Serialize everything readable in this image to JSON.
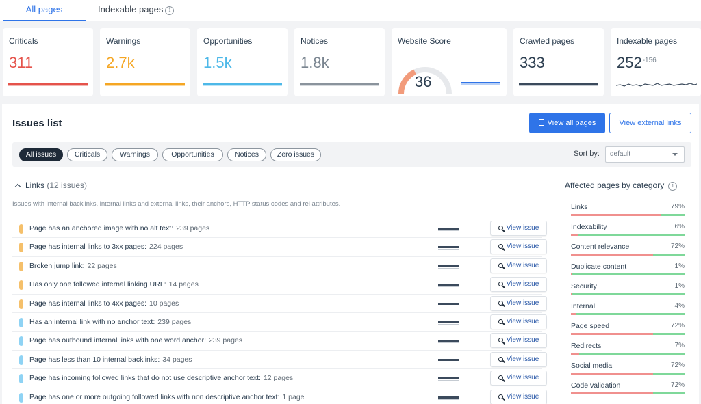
{
  "tabs": [
    {
      "label": "All pages",
      "active": true
    },
    {
      "label": "Indexable pages",
      "active": false
    }
  ],
  "cards": {
    "criticals": {
      "label": "Criticals",
      "value": "311",
      "color": "#e5534b"
    },
    "warnings": {
      "label": "Warnings",
      "value": "2.7k",
      "color": "#f5a623"
    },
    "opportunities": {
      "label": "Opportunities",
      "value": "1.5k",
      "color": "#4db8e8"
    },
    "notices": {
      "label": "Notices",
      "value": "1.8k",
      "color": "#8a939c"
    },
    "score": {
      "label": "Website Score",
      "value": "36",
      "percent": 36
    },
    "crawled": {
      "label": "Crawled pages",
      "value": "333"
    },
    "indexable": {
      "label": "Indexable pages",
      "value": "252",
      "delta": "-156"
    }
  },
  "issues_panel": {
    "title": "Issues list",
    "view_all_label": "View all pages",
    "view_external_label": "View external links",
    "filters": [
      "All issues",
      "Criticals",
      "Warnings",
      "Opportunities",
      "Notices",
      "Zero issues"
    ],
    "active_filter": "All issues",
    "sort_label": "Sort by:",
    "sort_value": "default",
    "group": {
      "name": "Links",
      "count": "(12 issues)",
      "description": "Issues with internal backlinks, internal links and external links, their anchors, HTTP status codes and rel attributes."
    },
    "view_issue_label": "View issue",
    "issues": [
      {
        "text": "Page has an anchored image with no alt text:",
        "count": "239 pages",
        "severity": "warning"
      },
      {
        "text": "Page has internal links to 3xx pages:",
        "count": "224 pages",
        "severity": "warning"
      },
      {
        "text": "Broken jump link:",
        "count": "22 pages",
        "severity": "warning"
      },
      {
        "text": "Has only one followed internal linking URL:",
        "count": "14 pages",
        "severity": "warning"
      },
      {
        "text": "Page has internal links to 4xx pages:",
        "count": "10 pages",
        "severity": "warning"
      },
      {
        "text": "Has an internal link with no anchor text:",
        "count": "239 pages",
        "severity": "opportunity"
      },
      {
        "text": "Page has outbound internal links with one word anchor:",
        "count": "239 pages",
        "severity": "opportunity"
      },
      {
        "text": "Page has less than 10 internal backlinks:",
        "count": "34 pages",
        "severity": "opportunity"
      },
      {
        "text": "Page has incoming followed links that do not use descriptive anchor text:",
        "count": "12 pages",
        "severity": "opportunity"
      },
      {
        "text": "Page has one or more outgoing followed links with non descriptive anchor text:",
        "count": "1 page",
        "severity": "opportunity"
      }
    ],
    "severity_colors": {
      "warning": "#f5c06b",
      "opportunity": "#8fd3f4"
    }
  },
  "affected": {
    "title": "Affected pages by category",
    "categories": [
      {
        "name": "Links",
        "percent": "79%",
        "value": 79
      },
      {
        "name": "Indexability",
        "percent": "6%",
        "value": 6
      },
      {
        "name": "Content relevance",
        "percent": "72%",
        "value": 72
      },
      {
        "name": "Duplicate content",
        "percent": "1%",
        "value": 1
      },
      {
        "name": "Security",
        "percent": "1%",
        "value": 1
      },
      {
        "name": "Internal",
        "percent": "4%",
        "value": 4
      },
      {
        "name": "Page speed",
        "percent": "72%",
        "value": 72
      },
      {
        "name": "Redirects",
        "percent": "7%",
        "value": 7
      },
      {
        "name": "Social media",
        "percent": "72%",
        "value": 72
      },
      {
        "name": "Code validation",
        "percent": "72%",
        "value": 72
      }
    ]
  }
}
